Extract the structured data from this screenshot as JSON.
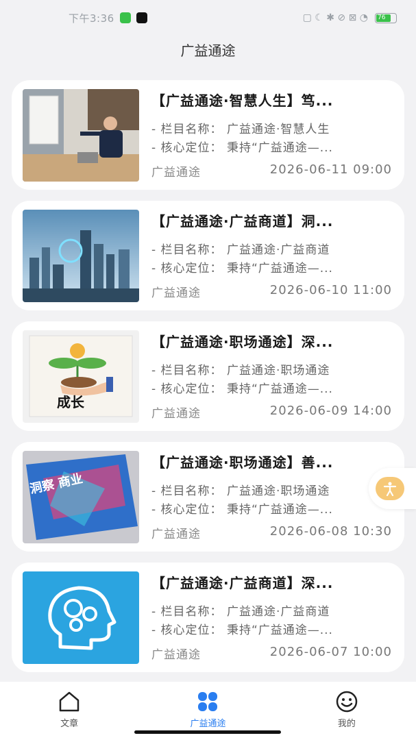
{
  "status_bar": {
    "time": "下午3:36",
    "battery": "76"
  },
  "header": {
    "title": "广益通途"
  },
  "articles": [
    {
      "title": "【广益通途·智慧人生】笃...",
      "column": "- 栏目名称： 广益通途·智慧人生",
      "position": "- 核心定位： 秉持“广益通途—...",
      "source": "广益通途",
      "date": "2026-06-11 09:00",
      "image": "business-presentation-photo"
    },
    {
      "title": "【广益通途·广益商道】洞...",
      "column": "- 栏目名称： 广益通途·广益商道",
      "position": "- 核心定位： 秉持“广益通途—...",
      "source": "广益通途",
      "date": "2026-06-10 11:00",
      "image": "smart-city-skyline-photo"
    },
    {
      "title": "【广益通途·职场通途】深...",
      "column": "- 栏目名称： 广益通途·职场通途",
      "position": "- 核心定位： 秉持“广益通途—...",
      "source": "广益通途",
      "date": "2026-06-09 14:00",
      "image": "growth-plant-illustration",
      "image_text": "成长"
    },
    {
      "title": "【广益通途·职场通途】善...",
      "column": "- 栏目名称： 广益通途·职场通途",
      "position": "- 核心定位： 秉持“广益通途—...",
      "source": "广益通途",
      "date": "2026-06-08 10:30",
      "image": "book-cover-photo",
      "image_text": "洞察 商业"
    },
    {
      "title": "【广益通途·广益商道】深...",
      "column": "- 栏目名称： 广益通途·广益商道",
      "position": "- 核心定位： 秉持“广益通途—...",
      "source": "广益通途",
      "date": "2026-06-07 10:00",
      "image": "head-gears-illustration"
    }
  ],
  "tabs": [
    {
      "label": "文章",
      "icon": "home-icon",
      "active": false
    },
    {
      "label": "广益通途",
      "icon": "apps-grid-icon",
      "active": true
    },
    {
      "label": "我的",
      "icon": "smiley-icon",
      "active": false
    }
  ],
  "colors": {
    "accent": "#2a7ef0",
    "float_button": "#f6c877",
    "background": "#f2f2f4"
  }
}
